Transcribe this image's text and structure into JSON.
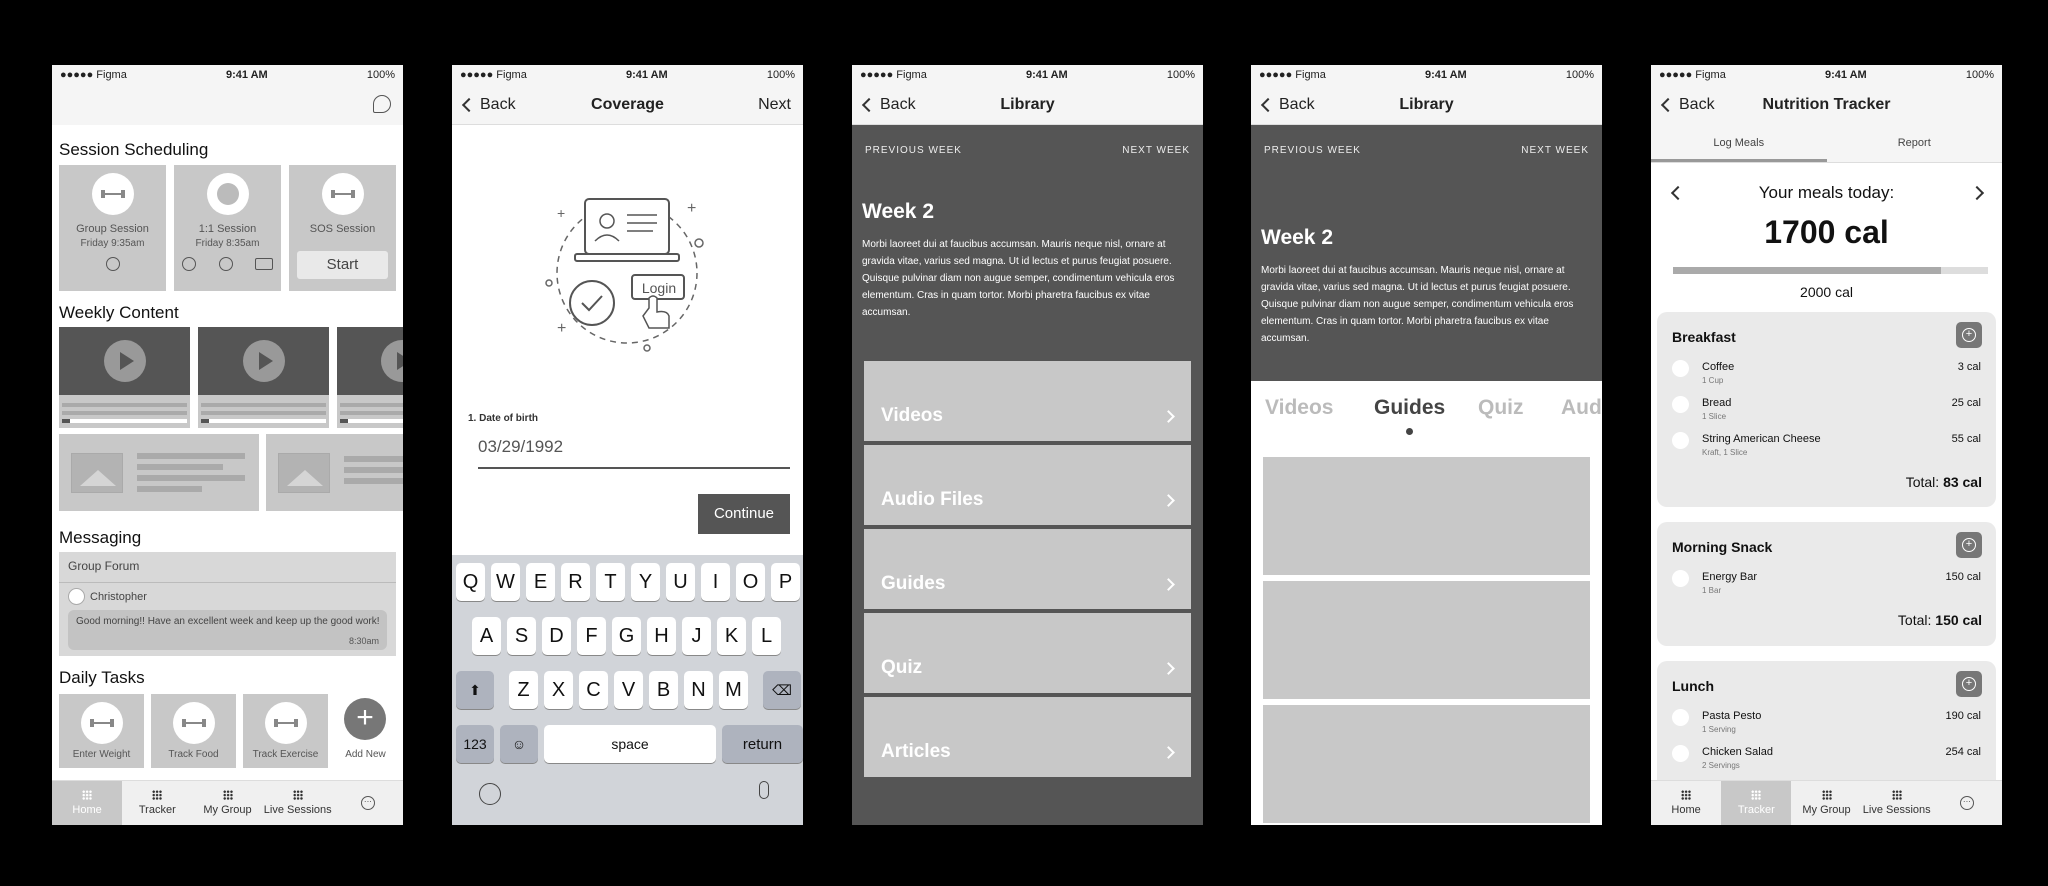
{
  "status": {
    "carrier": "●●●●● Figma",
    "time": "9:41 AM",
    "battery": "100%"
  },
  "phone1": {
    "sections": {
      "scheduling": "Session Scheduling",
      "weekly": "Weekly Content",
      "messaging": "Messaging",
      "tasks": "Daily Tasks"
    },
    "sessions": [
      {
        "label": "Group Session",
        "sub": "Friday 9:35am"
      },
      {
        "label": "1:1 Session",
        "sub": "Friday 8:35am"
      },
      {
        "label": "SOS Session",
        "button": "Start"
      }
    ],
    "forum": {
      "title": "Group Forum",
      "author": "Christopher",
      "message": "Good morning!! Have an excellent week and keep up the good work!",
      "time": "8:30am"
    },
    "tasks": [
      "Enter Weight",
      "Track Food",
      "Track Exercise",
      "Add New"
    ],
    "tabs": [
      "Home",
      "Tracker",
      "My Group",
      "Live Sessions"
    ]
  },
  "phone2": {
    "back": "Back",
    "title": "Coverage",
    "next": "Next",
    "illustration_button": "Login",
    "field_label": "1. Date of birth",
    "field_value": "03/29/1992",
    "continue": "Continue",
    "keys_row1": [
      "Q",
      "W",
      "E",
      "R",
      "T",
      "Y",
      "U",
      "I",
      "O",
      "P"
    ],
    "keys_row2": [
      "A",
      "S",
      "D",
      "F",
      "G",
      "H",
      "J",
      "K",
      "L"
    ],
    "keys_row3": [
      "Z",
      "X",
      "C",
      "V",
      "B",
      "N",
      "M"
    ],
    "key_123": "123",
    "key_space": "space",
    "key_return": "return"
  },
  "library": {
    "back": "Back",
    "title": "Library",
    "prev_week": "PREVIOUS WEEK",
    "next_week": "NEXT WEEK",
    "week": "Week 2",
    "body": "Morbi laoreet dui at faucibus accumsan. Mauris neque nisl, ornare at gravida vitae, varius sed magna. Ut id lectus et purus feugiat posuere. Quisque pulvinar diam non augue semper, condimentum vehicula eros elementum. Cras in quam tortor. Morbi pharetra faucibus ex vitae accumsan.",
    "rows": [
      "Videos",
      "Audio Files",
      "Guides",
      "Quiz",
      "Articles"
    ],
    "tabs": [
      "Videos",
      "Guides",
      "Quiz",
      "Aud"
    ]
  },
  "nutrition": {
    "back": "Back",
    "title": "Nutrition Tracker",
    "seg": [
      "Log Meals",
      "Report"
    ],
    "heading": "Your meals today:",
    "total": "1700 cal",
    "goal": "2000 cal",
    "progress": 0.85,
    "total_label": "Total:",
    "meals": [
      {
        "name": "Breakfast",
        "total": "83 cal",
        "items": [
          {
            "name": "Coffee",
            "sub": "1 Cup",
            "cal": "3 cal"
          },
          {
            "name": "Bread",
            "sub": "1 Slice",
            "cal": "25 cal"
          },
          {
            "name": "String American Cheese",
            "sub": "Kraft, 1 Slice",
            "cal": "55 cal"
          }
        ]
      },
      {
        "name": "Morning Snack",
        "total": "150 cal",
        "items": [
          {
            "name": "Energy Bar",
            "sub": "1 Bar",
            "cal": "150 cal"
          }
        ]
      },
      {
        "name": "Lunch",
        "items": [
          {
            "name": "Pasta Pesto",
            "sub": "1 Serving",
            "cal": "190 cal"
          },
          {
            "name": "Chicken Salad",
            "sub": "2 Servings",
            "cal": "254 cal"
          }
        ]
      }
    ],
    "tabs": [
      "Home",
      "Tracker",
      "My Group",
      "Live Sessions"
    ]
  }
}
